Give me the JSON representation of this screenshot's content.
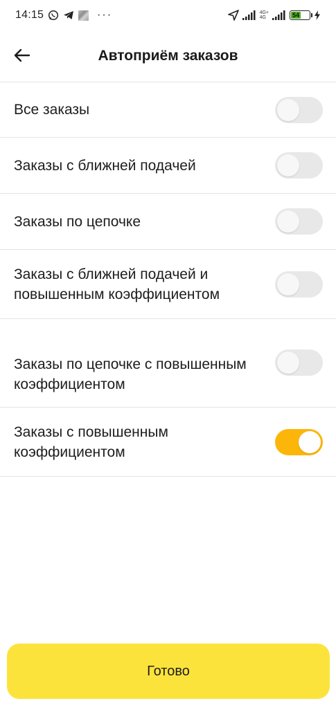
{
  "status_bar": {
    "time": "14:15",
    "dots": "···",
    "network": "4G+",
    "network_sub": "4G",
    "battery": "54",
    "battery_level": 0.54,
    "icons": [
      "whatsapp-icon",
      "telegram-icon",
      "app-icon",
      "location-arrow-icon",
      "signal-icon",
      "signal-icon",
      "battery-icon",
      "charging-icon"
    ]
  },
  "header": {
    "title": "Автоприём заказов",
    "back_icon": "arrow-left-icon"
  },
  "settings": [
    {
      "label": "Все заказы",
      "enabled": false
    },
    {
      "label": "Заказы с ближней подачей",
      "enabled": false
    },
    {
      "label": "Заказы по цепочке",
      "enabled": false
    },
    {
      "label": "Заказы с ближней подачей и повышенным коэффициентом",
      "enabled": false
    },
    {
      "label": "Заказы по цепочке с повышенным коэффициентом",
      "enabled": false
    },
    {
      "label": "Заказы с повышенным коэффициентом",
      "enabled": true
    }
  ],
  "colors": {
    "toggle_on": "#fcb60a",
    "toggle_off": "#e8e8e8",
    "primary_button": "#fce33c"
  },
  "footer": {
    "done_label": "Готово"
  }
}
